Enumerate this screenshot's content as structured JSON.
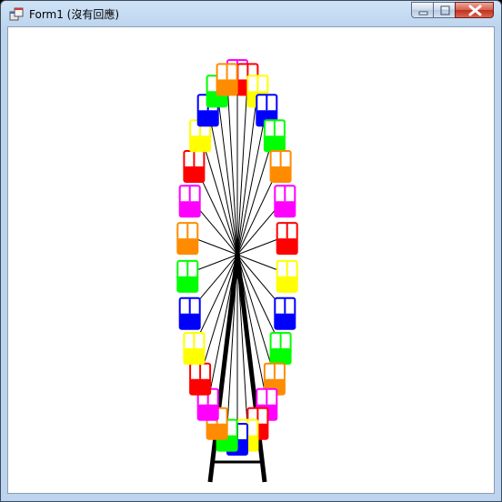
{
  "window": {
    "title": "Form1 (沒有回應)",
    "minimize_icon": "minimize-icon",
    "maximize_icon": "maximize-icon",
    "close_icon": "close-icon",
    "app_icon": "form-app-icon"
  },
  "colors": {
    "cabin_palette": [
      "#ff00ff",
      "#ff0000",
      "#ffff00",
      "#0000ff",
      "#00ff00",
      "#ff8c00"
    ],
    "spoke": "#000000",
    "support": "#000000",
    "background": "#ffffff"
  },
  "ferris_wheel": {
    "cabin_count": 30,
    "cabin_colors": [
      "#ff00ff",
      "#ff0000",
      "#ffff00",
      "#0000ff",
      "#00ff00",
      "#ff8c00",
      "#ff00ff",
      "#ff0000",
      "#ffff00",
      "#0000ff",
      "#00ff00",
      "#ff8c00",
      "#ff00ff",
      "#ff0000",
      "#ffff00",
      "#0000ff",
      "#00ff00",
      "#ff8c00",
      "#ff00ff",
      "#ff0000",
      "#ffff00",
      "#0000ff",
      "#00ff00",
      "#ff8c00",
      "#ff00ff",
      "#ff0000",
      "#ffff00",
      "#0000ff",
      "#00ff00",
      "#ff8c00"
    ]
  }
}
